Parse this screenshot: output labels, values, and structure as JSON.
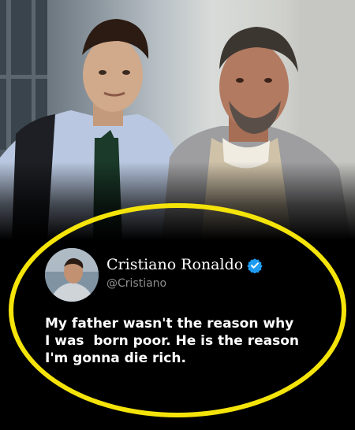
{
  "tweet": {
    "display_name": "Cristiano Ronaldo",
    "handle": "@Cristiano",
    "verified_icon": "verified-badge-icon",
    "text_lines": [
      "My father wasn't the reason why",
      "I was  born poor. He is the reason",
      "I'm gonna die rich."
    ]
  },
  "colors": {
    "highlight_oval": "#f5e40a",
    "verified_badge": "#1d9bf0",
    "background": "#000000",
    "handle_text": "#8e8e8e"
  }
}
